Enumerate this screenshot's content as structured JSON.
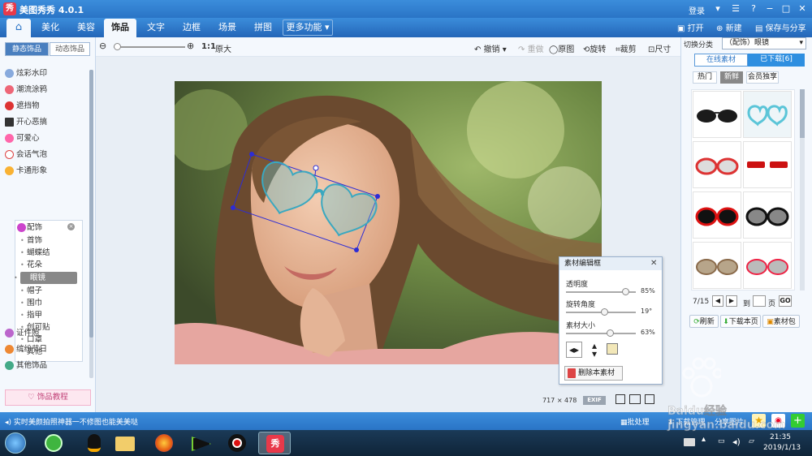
{
  "window": {
    "title": "美图秀秀 4.0.1",
    "logo_char": "秀",
    "login": "登录"
  },
  "nav": {
    "tabs": [
      "美化",
      "美容",
      "饰品",
      "文字",
      "边框",
      "场景",
      "拼图"
    ],
    "active": "饰品",
    "more": "更多功能",
    "right": {
      "open": "打开",
      "new": "新建",
      "save_share": "保存与分享"
    }
  },
  "toolbar": {
    "ratio": "1:1",
    "original_size": "原大",
    "undo": "撤销",
    "redo": "重做",
    "orig_image": "原图",
    "rotate": "旋转",
    "crop": "裁剪",
    "resize": "尺寸"
  },
  "left": {
    "tabs": [
      "静态饰品",
      "动态饰品"
    ],
    "items": [
      "炫彩水印",
      "潮流涂鸦",
      "遮挡物",
      "开心恶搞",
      "可爱心",
      "会话气泡",
      "卡通形象",
      "配饰"
    ],
    "sub_items": [
      "首饰",
      "蝴蝶结",
      "花朵",
      "眼镜",
      "帽子",
      "围巾",
      "指甲",
      "创可贴",
      "口罩",
      "其他"
    ],
    "selected_sub": "眼镜",
    "items_after": [
      "证件照",
      "缤纷节日",
      "其他饰品"
    ],
    "tutorial": "饰品教程"
  },
  "canvas": {
    "dims": "717 × 478",
    "exif": "EXIF"
  },
  "popup": {
    "title": "素材编辑框",
    "sliders": [
      {
        "label": "透明度",
        "value": 85,
        "display": "85%"
      },
      {
        "label": "旋转角度",
        "value": 19,
        "display": "19°"
      },
      {
        "label": "素材大小",
        "value": 63,
        "display": "63%"
      }
    ],
    "delete": "删除本素材"
  },
  "right": {
    "category_label": "切换分类",
    "category_value": "（配饰）眼镜",
    "tabs": [
      "在线素材",
      "已下载[6]"
    ],
    "subtabs": [
      "热门",
      "新鲜",
      "会员独享"
    ],
    "active_subtab": "新鲜",
    "page": "7/15",
    "goto": "到",
    "page_unit": "页",
    "go": "GO",
    "refresh": "刷新",
    "download_page": "下载本页",
    "material_pack": "素材包"
  },
  "status": {
    "tip": "实时美颜拍照神器一不修图也能美美哒",
    "batch": "批处理",
    "download_mgr": "下载管理",
    "share": "分享图片"
  },
  "taskbar": {
    "time": "21:35",
    "date": "2019/1/13"
  },
  "watermark": "Baidu经验 jingyan.baidu.com",
  "colors": {
    "titlebar": "#2a74c6",
    "accent": "#e8394a",
    "glasses_blue": "#5bc5d8"
  }
}
